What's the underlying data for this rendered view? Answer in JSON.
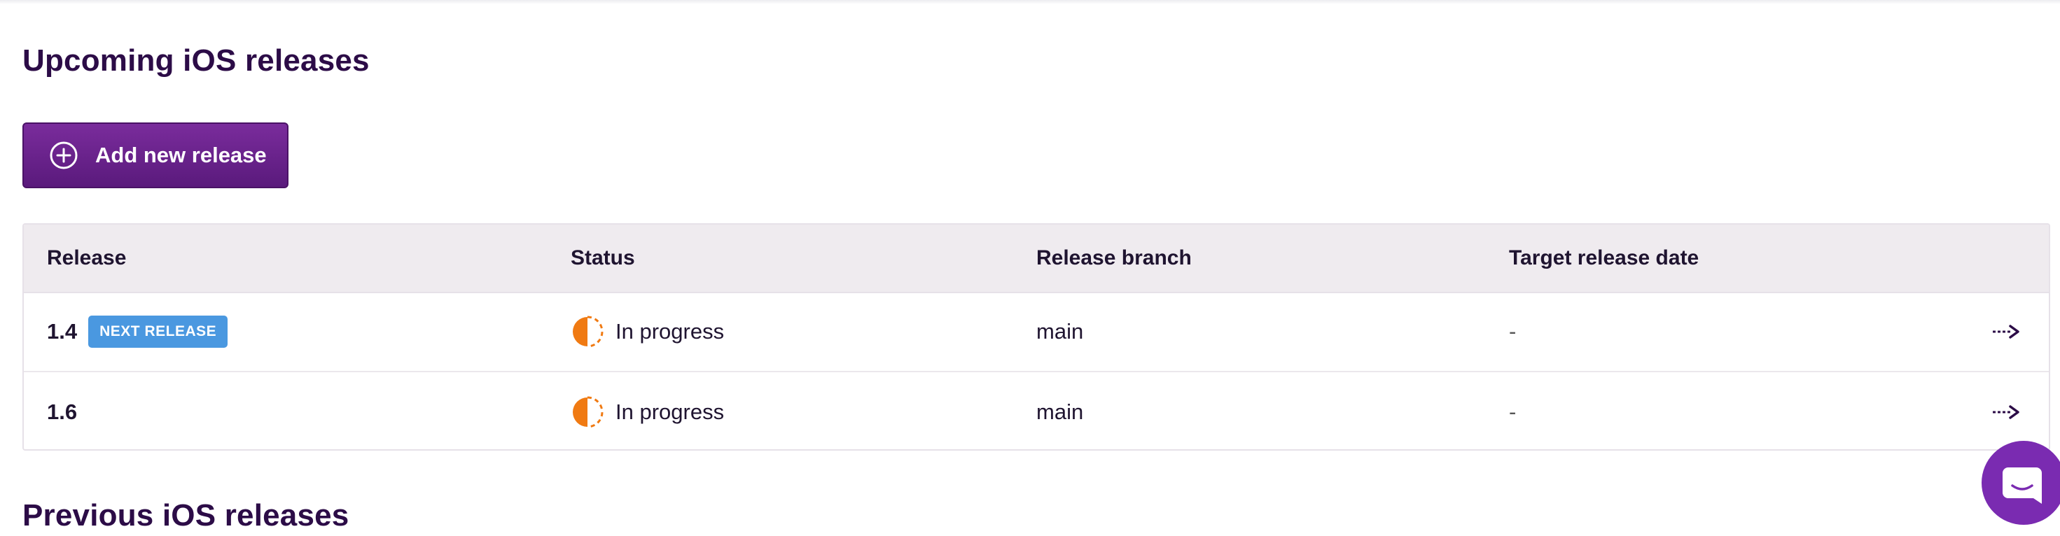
{
  "upcoming": {
    "title": "Upcoming iOS releases",
    "add_button_label": "Add new release"
  },
  "table": {
    "columns": [
      "Release",
      "Status",
      "Release branch",
      "Target release date"
    ],
    "rows": [
      {
        "release": "1.4",
        "badge": "NEXT RELEASE",
        "status": "In progress",
        "branch": "main",
        "target_date": "-"
      },
      {
        "release": "1.6",
        "badge": "",
        "status": "In progress",
        "branch": "main",
        "target_date": "-"
      }
    ]
  },
  "previous": {
    "title": "Previous iOS releases"
  },
  "icons": {
    "add": "plus-circle-icon",
    "status": "in-progress-half-circle-icon",
    "row_open": "dashed-arrow-right-icon",
    "chat": "chat-bubble-icon"
  },
  "colors": {
    "brand_purple": "#5a1a7c",
    "heading": "#2c0c47",
    "badge_blue": "#4a98e0",
    "status_orange": "#f07a12",
    "table_header_bg": "#efebef",
    "chat_fab": "#7a2bb1"
  }
}
